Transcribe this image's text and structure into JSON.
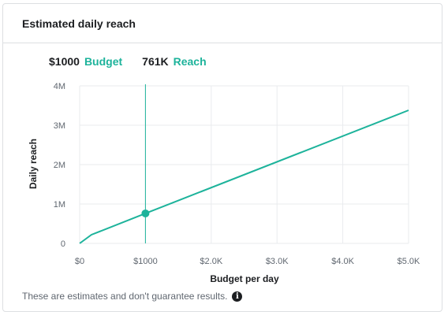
{
  "card": {
    "title": "Estimated daily reach"
  },
  "summary": {
    "budget_value": "$1000",
    "budget_label": "Budget",
    "reach_value": "761K",
    "reach_label": "Reach"
  },
  "footnote": {
    "text": "These are estimates and don't guarantee results.",
    "icon": "info-icon"
  },
  "colors": {
    "accent": "#1db39b",
    "text": "#1c1e21",
    "muted": "#606770",
    "grid": "#e9ebee"
  },
  "chart_data": {
    "type": "line",
    "xlabel": "Budget per day",
    "ylabel": "Daily reach",
    "xlim": [
      0,
      5000
    ],
    "ylim": [
      0,
      4000000
    ],
    "x_ticks": [
      {
        "value": 0,
        "label": "$0"
      },
      {
        "value": 1000,
        "label": "$1000"
      },
      {
        "value": 2000,
        "label": "$2.0K"
      },
      {
        "value": 3000,
        "label": "$3.0K"
      },
      {
        "value": 4000,
        "label": "$4.0K"
      },
      {
        "value": 5000,
        "label": "$5.0K"
      }
    ],
    "y_ticks": [
      {
        "value": 0,
        "label": "0"
      },
      {
        "value": 1000000,
        "label": "1M"
      },
      {
        "value": 2000000,
        "label": "2M"
      },
      {
        "value": 3000000,
        "label": "3M"
      },
      {
        "value": 4000000,
        "label": "4M"
      }
    ],
    "grid": true,
    "series": [
      {
        "x": [
          0,
          180,
          1000,
          5000
        ],
        "y": [
          0,
          220000,
          761000,
          3380000
        ]
      }
    ],
    "marker": {
      "x": 1000,
      "y": 761000
    }
  }
}
